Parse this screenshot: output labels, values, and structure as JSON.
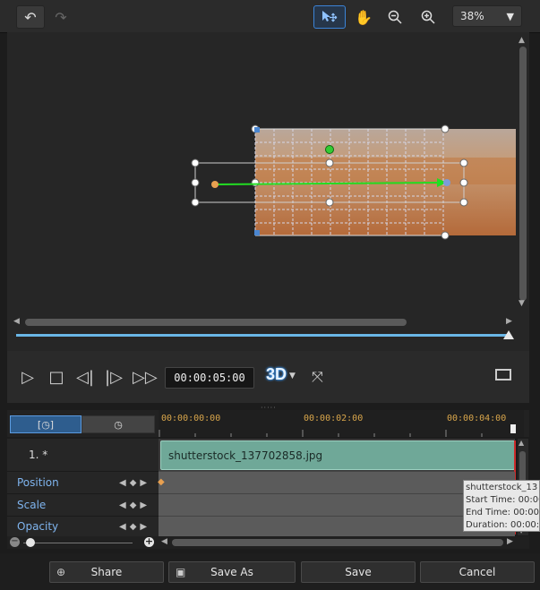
{
  "toolbar": {
    "undo_icon": "undo-icon",
    "redo_icon": "redo-icon",
    "zoom_value": "38%"
  },
  "player": {
    "timecode": "00:00:05:00",
    "three_d": "3D"
  },
  "timeline": {
    "ruler": [
      "00:00:00:00",
      "00:00:02:00",
      "00:00:04:00"
    ],
    "object_track_label": "1. *",
    "clip_name": "shutterstock_137702858.jpg",
    "properties": [
      "Position",
      "Scale",
      "Opacity"
    ],
    "tooltip": {
      "name": "shutterstock_13",
      "start": "Start Time: 00:00",
      "end": "End Time: 00:00",
      "duration": "Duration: 00:00:0"
    }
  },
  "buttons": {
    "share": "Share",
    "save_as": "Save As",
    "save": "Save",
    "cancel": "Cancel"
  },
  "colors": {
    "accent": "#6ab6e6",
    "clip": "#6fa898",
    "motion_path": "#22dd22",
    "ruler_text": "#d9a64b"
  }
}
